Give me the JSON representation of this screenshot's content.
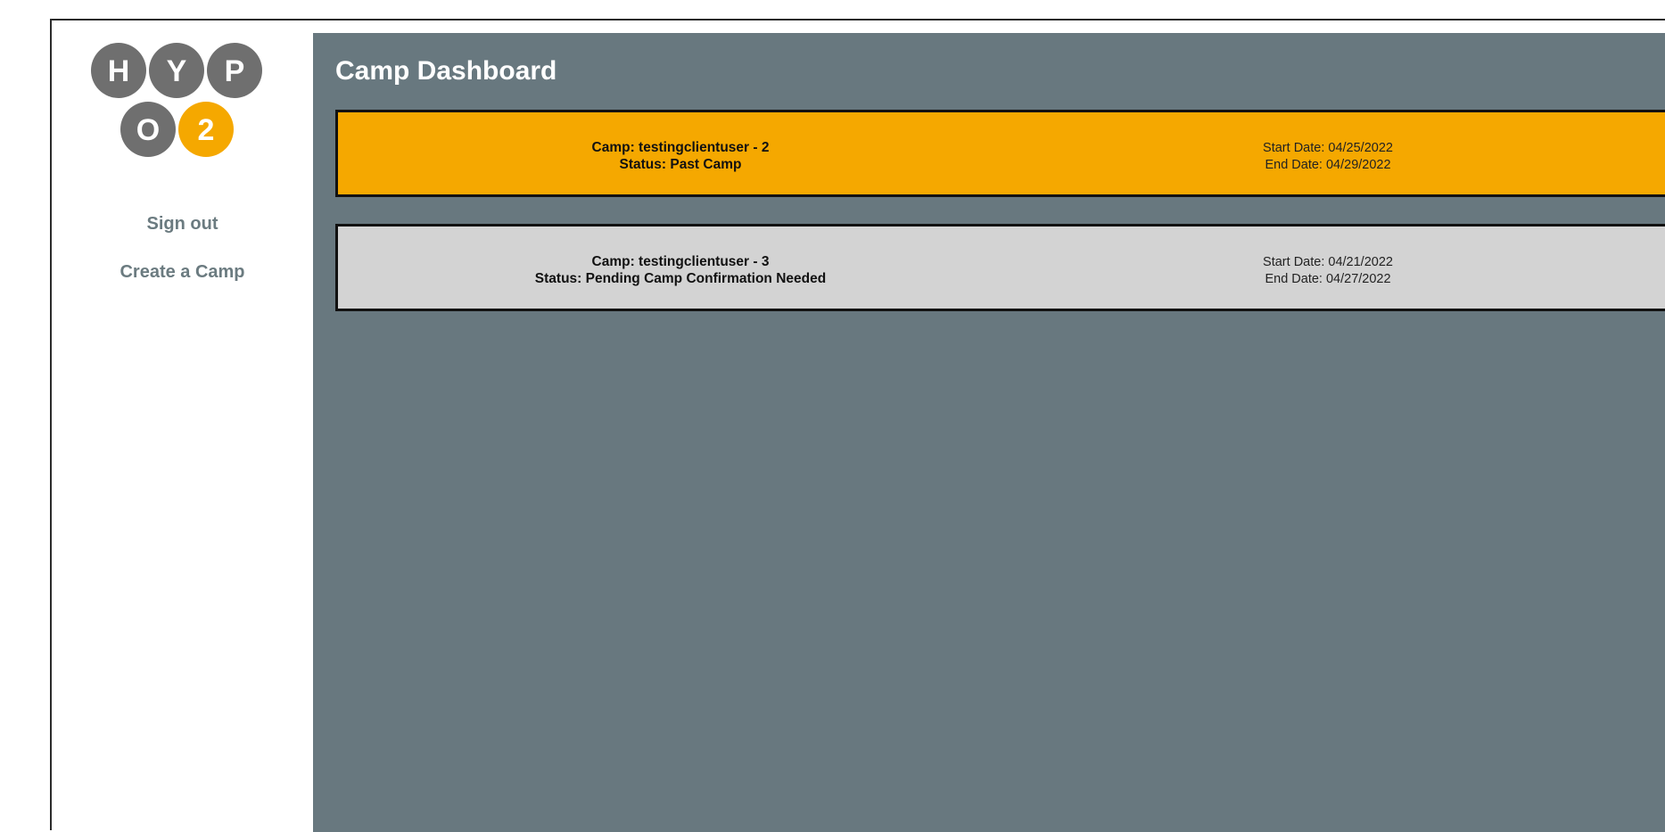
{
  "logo": {
    "letters_top": [
      "H",
      "Y",
      "P"
    ],
    "letters_bottom": [
      "O",
      "2"
    ],
    "colors": {
      "gray": "#6f6f6f",
      "accent": "#f5a800"
    }
  },
  "sidebar": {
    "links": [
      {
        "label": "Sign out"
      },
      {
        "label": "Create a Camp"
      }
    ]
  },
  "main": {
    "title": "Camp Dashboard",
    "camps": [
      {
        "camp_line": "Camp: testingclientuser - 2",
        "status_line": "Status: Past Camp",
        "start_line": "Start Date: 04/25/2022",
        "end_line": "End Date: 04/29/2022",
        "color": "#f5a800"
      },
      {
        "camp_line": "Camp: testingclientuser - 3",
        "status_line": "Status: Pending Camp Confirmation Needed",
        "start_line": "Start Date: 04/21/2022",
        "end_line": "End Date: 04/27/2022",
        "color": "#d3d3d3"
      }
    ]
  },
  "theme": {
    "main_bg": "#68787f",
    "link_color": "#6b7b80"
  }
}
